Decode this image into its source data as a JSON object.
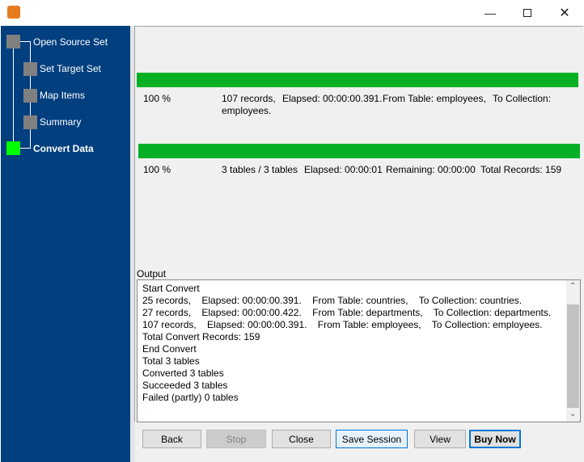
{
  "window": {
    "minimize_icon": "minimize-icon",
    "maximize_icon": "maximize-icon",
    "close_icon": "close-icon"
  },
  "steps": [
    {
      "label": "Open Source Set",
      "state": "done"
    },
    {
      "label": "Set Target Set",
      "state": "done"
    },
    {
      "label": "Map Items",
      "state": "done"
    },
    {
      "label": "Summary",
      "state": "done"
    },
    {
      "label": "Convert Data",
      "state": "current"
    }
  ],
  "colors": {
    "sidebar": "#013f7f",
    "progress": "#06b025",
    "current_step": "#00ff00"
  },
  "table_progress": {
    "percent_value": 100,
    "percent": "100 %",
    "records": "107 records,",
    "elapsed": "Elapsed: 00:00:00.391.",
    "from": "From Table: employees,",
    "to": "To Collection:",
    "to_cont": "employees."
  },
  "total_progress": {
    "percent_value": 100,
    "percent": "100 %",
    "tables": "3 tables / 3 tables",
    "elapsed": "Elapsed: 00:00:01",
    "remaining": "Remaining: 00:00:00",
    "total": "Total Records: 159"
  },
  "output": {
    "label": "Output",
    "lines": [
      "Start Convert",
      "25 records,    Elapsed: 00:00:00.391.    From Table: countries,    To Collection: countries.",
      "27 records,    Elapsed: 00:00:00.422.    From Table: departments,    To Collection: departments.",
      "107 records,    Elapsed: 00:00:00.391.    From Table: employees,    To Collection: employees.",
      "Total Convert Records: 159",
      "End Convert",
      "Total 3 tables",
      "Converted 3 tables",
      "Succeeded 3 tables",
      "Failed (partly) 0 tables"
    ]
  },
  "buttons": {
    "back": "Back",
    "stop": "Stop",
    "close": "Close",
    "save_session": "Save Session",
    "view": "View",
    "buy_now": "Buy Now"
  }
}
